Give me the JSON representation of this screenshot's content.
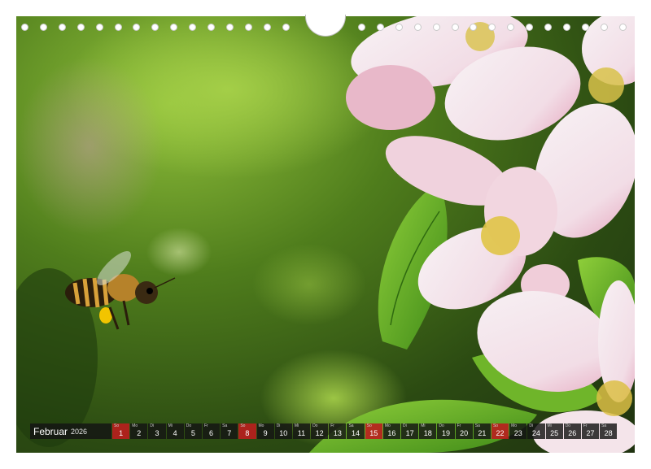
{
  "calendar": {
    "month": "Februar",
    "year": "2026",
    "days": [
      {
        "wd": "So",
        "num": "1",
        "sunday": true
      },
      {
        "wd": "Mo",
        "num": "2"
      },
      {
        "wd": "Di",
        "num": "3"
      },
      {
        "wd": "Mi",
        "num": "4"
      },
      {
        "wd": "Do",
        "num": "5"
      },
      {
        "wd": "Fr",
        "num": "6"
      },
      {
        "wd": "Sa",
        "num": "7"
      },
      {
        "wd": "So",
        "num": "8",
        "sunday": true
      },
      {
        "wd": "Mo",
        "num": "9"
      },
      {
        "wd": "Di",
        "num": "10"
      },
      {
        "wd": "Mi",
        "num": "11"
      },
      {
        "wd": "Do",
        "num": "12"
      },
      {
        "wd": "Fr",
        "num": "13"
      },
      {
        "wd": "Sa",
        "num": "14"
      },
      {
        "wd": "So",
        "num": "15",
        "sunday": true
      },
      {
        "wd": "Mo",
        "num": "16"
      },
      {
        "wd": "Di",
        "num": "17"
      },
      {
        "wd": "Mi",
        "num": "18"
      },
      {
        "wd": "Do",
        "num": "19"
      },
      {
        "wd": "Fr",
        "num": "20"
      },
      {
        "wd": "Sa",
        "num": "21"
      },
      {
        "wd": "So",
        "num": "22",
        "sunday": true
      },
      {
        "wd": "Mo",
        "num": "23"
      },
      {
        "wd": "Di",
        "num": "24"
      },
      {
        "wd": "Mi",
        "num": "25"
      },
      {
        "wd": "Do",
        "num": "26"
      },
      {
        "wd": "Fr",
        "num": "27"
      },
      {
        "wd": "Sa",
        "num": "28"
      }
    ]
  },
  "colors": {
    "sunday": "#ba1e1e",
    "strip": "#141414"
  }
}
